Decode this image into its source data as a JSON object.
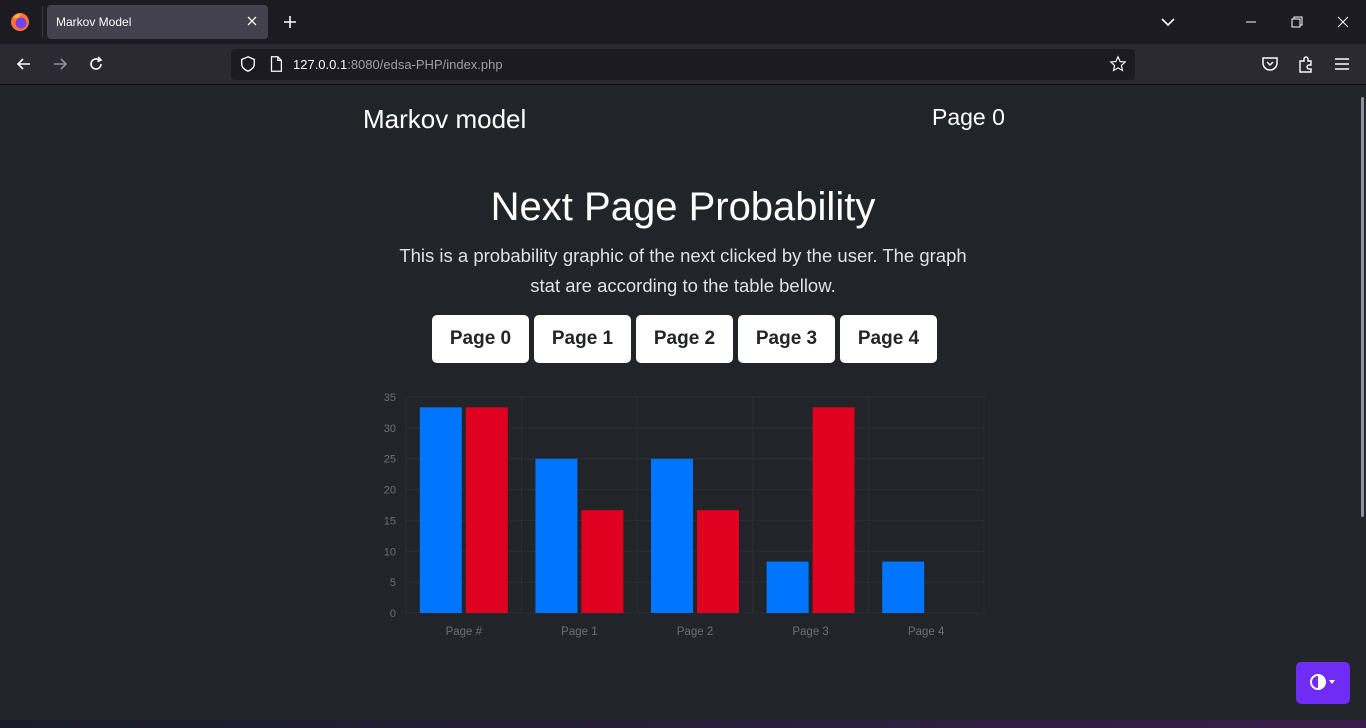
{
  "browser": {
    "tab_title": "Markov Model",
    "url_host": "127.0.0.1",
    "url_rest": ":8080/edsa-PHP/index.php"
  },
  "page": {
    "brand": "Markov model",
    "current_page": "Page 0",
    "heading": "Next Page Probability",
    "lead": "This is a probability graphic of the next clicked by the user. The graph stat are according to the table bellow.",
    "buttons": [
      "Page 0",
      "Page 1",
      "Page 2",
      "Page 3",
      "Page 4"
    ]
  },
  "colors": {
    "series_blue": "#0075ff",
    "series_red": "#e00020",
    "theme_button": "#6f2cf5"
  },
  "chart_data": {
    "type": "bar",
    "categories": [
      "Page #",
      "Page 1",
      "Page 2",
      "Page 3",
      "Page 4"
    ],
    "series": [
      {
        "values": [
          33.33,
          25,
          25,
          8.33,
          8.33
        ]
      },
      {
        "values": [
          33.33,
          16.67,
          16.67,
          33.33,
          0
        ]
      }
    ],
    "yticks": [
      0,
      5,
      10,
      15,
      20,
      25,
      30,
      35
    ],
    "ylim": [
      0,
      35
    ],
    "grid": true,
    "title": "",
    "xlabel": "",
    "ylabel": ""
  }
}
